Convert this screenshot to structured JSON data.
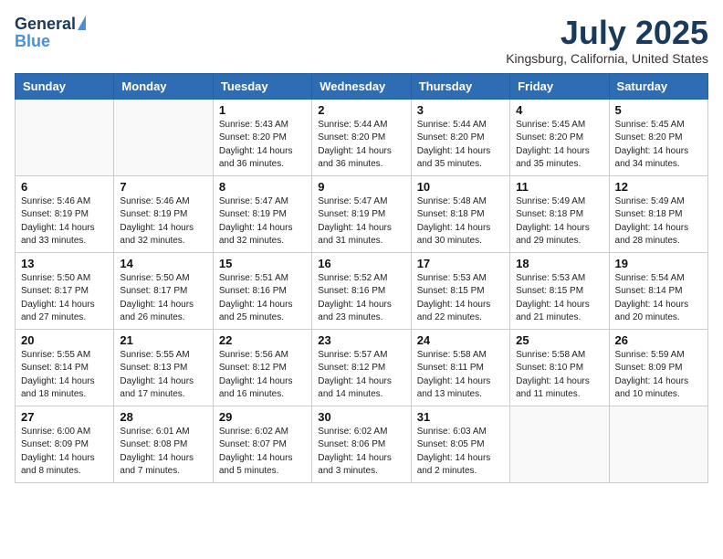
{
  "header": {
    "logo_general": "General",
    "logo_blue": "Blue",
    "month_year": "July 2025",
    "location": "Kingsburg, California, United States"
  },
  "weekdays": [
    "Sunday",
    "Monday",
    "Tuesday",
    "Wednesday",
    "Thursday",
    "Friday",
    "Saturday"
  ],
  "weeks": [
    [
      {
        "day": "",
        "empty": true
      },
      {
        "day": "",
        "empty": true
      },
      {
        "day": "1",
        "sunrise": "Sunrise: 5:43 AM",
        "sunset": "Sunset: 8:20 PM",
        "daylight": "Daylight: 14 hours and 36 minutes."
      },
      {
        "day": "2",
        "sunrise": "Sunrise: 5:44 AM",
        "sunset": "Sunset: 8:20 PM",
        "daylight": "Daylight: 14 hours and 36 minutes."
      },
      {
        "day": "3",
        "sunrise": "Sunrise: 5:44 AM",
        "sunset": "Sunset: 8:20 PM",
        "daylight": "Daylight: 14 hours and 35 minutes."
      },
      {
        "day": "4",
        "sunrise": "Sunrise: 5:45 AM",
        "sunset": "Sunset: 8:20 PM",
        "daylight": "Daylight: 14 hours and 35 minutes."
      },
      {
        "day": "5",
        "sunrise": "Sunrise: 5:45 AM",
        "sunset": "Sunset: 8:20 PM",
        "daylight": "Daylight: 14 hours and 34 minutes."
      }
    ],
    [
      {
        "day": "6",
        "sunrise": "Sunrise: 5:46 AM",
        "sunset": "Sunset: 8:19 PM",
        "daylight": "Daylight: 14 hours and 33 minutes."
      },
      {
        "day": "7",
        "sunrise": "Sunrise: 5:46 AM",
        "sunset": "Sunset: 8:19 PM",
        "daylight": "Daylight: 14 hours and 32 minutes."
      },
      {
        "day": "8",
        "sunrise": "Sunrise: 5:47 AM",
        "sunset": "Sunset: 8:19 PM",
        "daylight": "Daylight: 14 hours and 32 minutes."
      },
      {
        "day": "9",
        "sunrise": "Sunrise: 5:47 AM",
        "sunset": "Sunset: 8:19 PM",
        "daylight": "Daylight: 14 hours and 31 minutes."
      },
      {
        "day": "10",
        "sunrise": "Sunrise: 5:48 AM",
        "sunset": "Sunset: 8:18 PM",
        "daylight": "Daylight: 14 hours and 30 minutes."
      },
      {
        "day": "11",
        "sunrise": "Sunrise: 5:49 AM",
        "sunset": "Sunset: 8:18 PM",
        "daylight": "Daylight: 14 hours and 29 minutes."
      },
      {
        "day": "12",
        "sunrise": "Sunrise: 5:49 AM",
        "sunset": "Sunset: 8:18 PM",
        "daylight": "Daylight: 14 hours and 28 minutes."
      }
    ],
    [
      {
        "day": "13",
        "sunrise": "Sunrise: 5:50 AM",
        "sunset": "Sunset: 8:17 PM",
        "daylight": "Daylight: 14 hours and 27 minutes."
      },
      {
        "day": "14",
        "sunrise": "Sunrise: 5:50 AM",
        "sunset": "Sunset: 8:17 PM",
        "daylight": "Daylight: 14 hours and 26 minutes."
      },
      {
        "day": "15",
        "sunrise": "Sunrise: 5:51 AM",
        "sunset": "Sunset: 8:16 PM",
        "daylight": "Daylight: 14 hours and 25 minutes."
      },
      {
        "day": "16",
        "sunrise": "Sunrise: 5:52 AM",
        "sunset": "Sunset: 8:16 PM",
        "daylight": "Daylight: 14 hours and 23 minutes."
      },
      {
        "day": "17",
        "sunrise": "Sunrise: 5:53 AM",
        "sunset": "Sunset: 8:15 PM",
        "daylight": "Daylight: 14 hours and 22 minutes."
      },
      {
        "day": "18",
        "sunrise": "Sunrise: 5:53 AM",
        "sunset": "Sunset: 8:15 PM",
        "daylight": "Daylight: 14 hours and 21 minutes."
      },
      {
        "day": "19",
        "sunrise": "Sunrise: 5:54 AM",
        "sunset": "Sunset: 8:14 PM",
        "daylight": "Daylight: 14 hours and 20 minutes."
      }
    ],
    [
      {
        "day": "20",
        "sunrise": "Sunrise: 5:55 AM",
        "sunset": "Sunset: 8:14 PM",
        "daylight": "Daylight: 14 hours and 18 minutes."
      },
      {
        "day": "21",
        "sunrise": "Sunrise: 5:55 AM",
        "sunset": "Sunset: 8:13 PM",
        "daylight": "Daylight: 14 hours and 17 minutes."
      },
      {
        "day": "22",
        "sunrise": "Sunrise: 5:56 AM",
        "sunset": "Sunset: 8:12 PM",
        "daylight": "Daylight: 14 hours and 16 minutes."
      },
      {
        "day": "23",
        "sunrise": "Sunrise: 5:57 AM",
        "sunset": "Sunset: 8:12 PM",
        "daylight": "Daylight: 14 hours and 14 minutes."
      },
      {
        "day": "24",
        "sunrise": "Sunrise: 5:58 AM",
        "sunset": "Sunset: 8:11 PM",
        "daylight": "Daylight: 14 hours and 13 minutes."
      },
      {
        "day": "25",
        "sunrise": "Sunrise: 5:58 AM",
        "sunset": "Sunset: 8:10 PM",
        "daylight": "Daylight: 14 hours and 11 minutes."
      },
      {
        "day": "26",
        "sunrise": "Sunrise: 5:59 AM",
        "sunset": "Sunset: 8:09 PM",
        "daylight": "Daylight: 14 hours and 10 minutes."
      }
    ],
    [
      {
        "day": "27",
        "sunrise": "Sunrise: 6:00 AM",
        "sunset": "Sunset: 8:09 PM",
        "daylight": "Daylight: 14 hours and 8 minutes."
      },
      {
        "day": "28",
        "sunrise": "Sunrise: 6:01 AM",
        "sunset": "Sunset: 8:08 PM",
        "daylight": "Daylight: 14 hours and 7 minutes."
      },
      {
        "day": "29",
        "sunrise": "Sunrise: 6:02 AM",
        "sunset": "Sunset: 8:07 PM",
        "daylight": "Daylight: 14 hours and 5 minutes."
      },
      {
        "day": "30",
        "sunrise": "Sunrise: 6:02 AM",
        "sunset": "Sunset: 8:06 PM",
        "daylight": "Daylight: 14 hours and 3 minutes."
      },
      {
        "day": "31",
        "sunrise": "Sunrise: 6:03 AM",
        "sunset": "Sunset: 8:05 PM",
        "daylight": "Daylight: 14 hours and 2 minutes."
      },
      {
        "day": "",
        "empty": true
      },
      {
        "day": "",
        "empty": true
      }
    ]
  ]
}
